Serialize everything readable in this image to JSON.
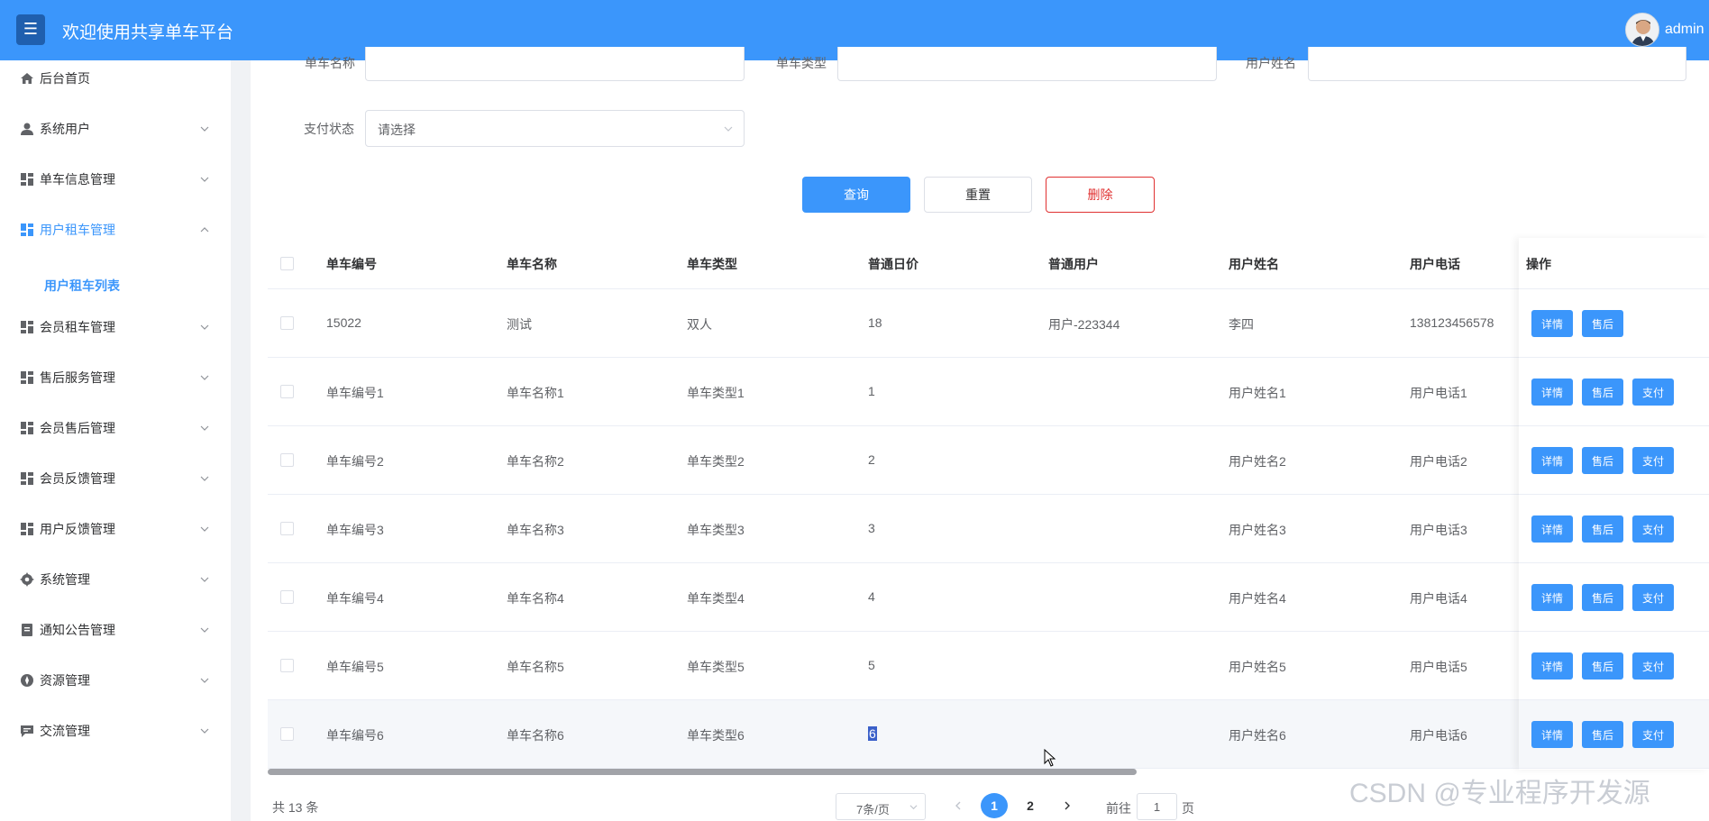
{
  "header": {
    "menu_icon": "hamburger-icon",
    "title": "欢迎使用共享单车平台",
    "user": "admin"
  },
  "sidebar": {
    "items": [
      {
        "label": "后台首页",
        "icon": "home-icon"
      },
      {
        "label": "系统用户",
        "icon": "user-icon"
      },
      {
        "label": "单车信息管理",
        "icon": "grid-icon"
      },
      {
        "label": "用户租车管理",
        "icon": "grid-icon",
        "expanded": true
      },
      {
        "label": "会员租车管理",
        "icon": "grid-icon"
      },
      {
        "label": "售后服务管理",
        "icon": "grid-icon"
      },
      {
        "label": "会员售后管理",
        "icon": "grid-icon"
      },
      {
        "label": "会员反馈管理",
        "icon": "grid-icon"
      },
      {
        "label": "用户反馈管理",
        "icon": "grid-icon"
      },
      {
        "label": "系统管理",
        "icon": "gear-icon"
      },
      {
        "label": "通知公告管理",
        "icon": "notice-icon"
      },
      {
        "label": "资源管理",
        "icon": "compass-icon"
      },
      {
        "label": "交流管理",
        "icon": "chat-icon"
      }
    ],
    "sub_item": "用户租车列表"
  },
  "filters": {
    "bike_name_label": "单车名称",
    "bike_type_label": "单车类型",
    "user_name_label": "用户姓名",
    "pay_status_label": "支付状态",
    "pay_status_placeholder": "请选择",
    "query_button": "查询",
    "reset_button": "重置",
    "delete_button": "删除"
  },
  "table": {
    "headers": [
      "单车编号",
      "单车名称",
      "单车类型",
      "普通日价",
      "普通用户",
      "用户姓名",
      "用户电话",
      "操作"
    ],
    "rows": [
      [
        "15022",
        "测试",
        "双人",
        "18",
        "用户-223344",
        "李四",
        "138123456578"
      ],
      [
        "单车编号1",
        "单车名称1",
        "单车类型1",
        "1",
        "",
        "用户姓名1",
        "用户电话1"
      ],
      [
        "单车编号2",
        "单车名称2",
        "单车类型2",
        "2",
        "",
        "用户姓名2",
        "用户电话2"
      ],
      [
        "单车编号3",
        "单车名称3",
        "单车类型3",
        "3",
        "",
        "用户姓名3",
        "用户电话3"
      ],
      [
        "单车编号4",
        "单车名称4",
        "单车类型4",
        "4",
        "",
        "用户姓名4",
        "用户电话4"
      ],
      [
        "单车编号5",
        "单车名称5",
        "单车类型5",
        "5",
        "",
        "用户姓名5",
        "用户电话5"
      ],
      [
        "单车编号6",
        "单车名称6",
        "单车类型6",
        "6",
        "",
        "用户姓名6",
        "用户电话6"
      ]
    ],
    "op_detail": "详情",
    "op_aftersale": "售后",
    "op_pay": "支付"
  },
  "pagination": {
    "total": "共 13 条",
    "page_size": "7条/页",
    "pages": [
      "1",
      "2"
    ],
    "goto_prefix": "前往",
    "goto_value": "1",
    "goto_suffix": "页"
  },
  "watermark": "CSDN @专业程序开发源",
  "colors": {
    "primary": "#3b96fb",
    "danger": "#e03131"
  }
}
